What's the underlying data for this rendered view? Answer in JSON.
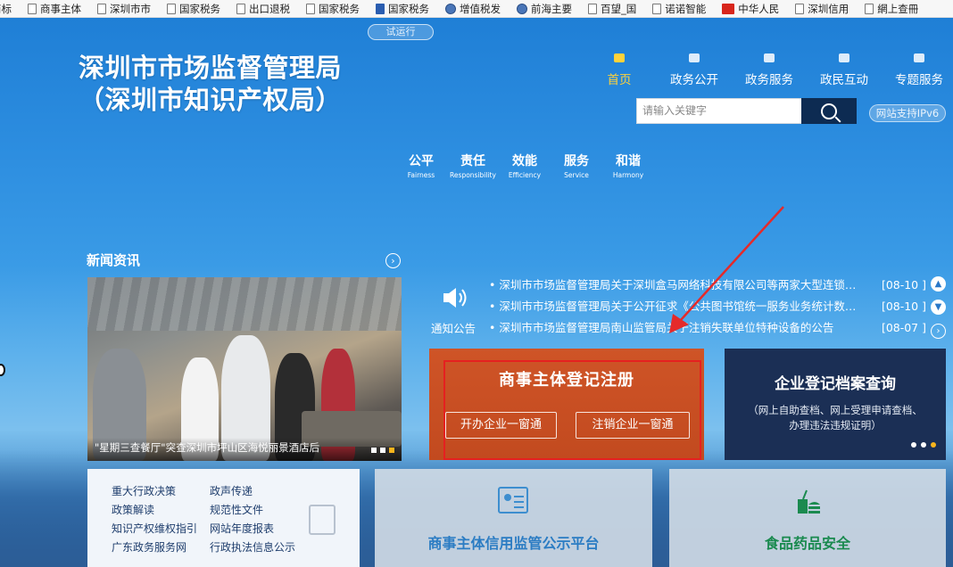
{
  "bookmarks": [
    {
      "label": "商标",
      "icon": "page-icon"
    },
    {
      "label": "商事主体",
      "icon": "page-icon"
    },
    {
      "label": "深圳市市",
      "icon": "page-icon"
    },
    {
      "label": "国家税务",
      "icon": "page-icon"
    },
    {
      "label": "出口退税",
      "icon": "page-icon"
    },
    {
      "label": "国家税务",
      "icon": "page-icon"
    },
    {
      "label": "国家税务",
      "icon": "tax-icon"
    },
    {
      "label": "增值税发",
      "icon": "globe-icon"
    },
    {
      "label": "前海主要",
      "icon": "globe-icon"
    },
    {
      "label": "百望_国",
      "icon": "page-icon"
    },
    {
      "label": "诺诺智能",
      "icon": "page-icon"
    },
    {
      "label": "中华人民",
      "icon": "red-icon"
    },
    {
      "label": "深圳信用",
      "icon": "page-icon"
    },
    {
      "label": "網上查冊",
      "icon": "page-icon"
    }
  ],
  "header": {
    "trial": "试运行",
    "title_line1": "深圳市市场监督管理局",
    "title_line2": "（深圳市知识产权局）",
    "nav": [
      {
        "label": "首页",
        "active": true
      },
      {
        "label": "政务公开",
        "active": false
      },
      {
        "label": "政务服务",
        "active": false
      },
      {
        "label": "政民互动",
        "active": false
      },
      {
        "label": "专题服务",
        "active": false
      }
    ],
    "search_placeholder": "请输入关键字",
    "ipv6": "网站支持IPv6"
  },
  "values": [
    {
      "zh": "公平",
      "en": "Fairness"
    },
    {
      "zh": "责任",
      "en": "Responsibility"
    },
    {
      "zh": "效能",
      "en": "Efficiency"
    },
    {
      "zh": "服务",
      "en": "Service"
    },
    {
      "zh": "和谐",
      "en": "Harmony"
    }
  ],
  "news": {
    "title": "新闻资讯",
    "more": "›",
    "caption": "\"星期三查餐厅\"突查深圳市坪山区海悦丽景酒店后"
  },
  "notices": {
    "label": "通知公告",
    "items": [
      {
        "title": "• 深圳市市场监督管理局关于深圳盒马网络科技有限公司等两家大型连锁食...",
        "date": "[08-10 ]"
      },
      {
        "title": "• 深圳市市场监督管理局关于公开征求《公共图书馆统一服务业务统计数据...",
        "date": "[08-10 ]"
      },
      {
        "title": "• 深圳市市场监督管理局南山监管局关于注销失联单位特种设备的公告",
        "date": "[08-07 ]"
      }
    ]
  },
  "registration": {
    "title": "商事主体登记注册",
    "btn_open": "开办企业一窗通",
    "btn_close": "注销企业一窗通"
  },
  "archive": {
    "title": "企业登记档案查询",
    "sub_line1": "（网上自助查档、网上受理申请查档、",
    "sub_line2": "办理违法违规证明）"
  },
  "links": {
    "col1": [
      "重大行政决策",
      "政策解读",
      "知识产权维权指引",
      "广东政务服务网"
    ],
    "col2": [
      "政声传递",
      "规范性文件",
      "网站年度报表",
      "行政执法信息公示"
    ]
  },
  "credit": {
    "title": "商事主体信用监管公示平台"
  },
  "food": {
    "title": "食品药品安全"
  },
  "colors": {
    "accent": "#ffd23a",
    "registration": "#c94f22",
    "archive": "#1b2f55",
    "highlight": "#e52020"
  }
}
